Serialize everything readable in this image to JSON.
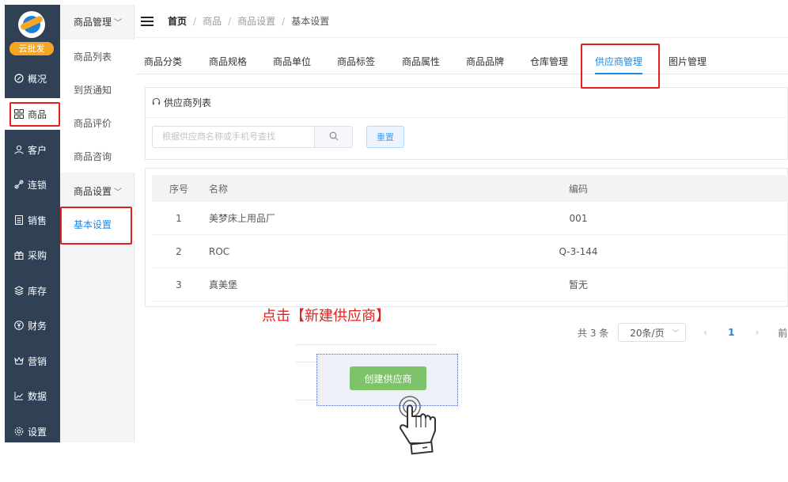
{
  "nav": {
    "brand": "云批发",
    "items": [
      {
        "label": "概况",
        "icon": "dashboard-icon"
      },
      {
        "label": "商品",
        "icon": "grid-icon"
      },
      {
        "label": "客户",
        "icon": "user-icon"
      },
      {
        "label": "连锁",
        "icon": "link-icon"
      },
      {
        "label": "销售",
        "icon": "document-icon"
      },
      {
        "label": "采购",
        "icon": "gift-icon"
      },
      {
        "label": "库存",
        "icon": "layers-icon"
      },
      {
        "label": "财务",
        "icon": "yen-icon"
      },
      {
        "label": "营销",
        "icon": "crown-icon"
      },
      {
        "label": "数据",
        "icon": "chart-icon"
      },
      {
        "label": "设置",
        "icon": "gear-icon"
      }
    ],
    "active": "商品"
  },
  "submenu": {
    "group1": "商品管理",
    "group1_items": [
      "商品列表",
      "到货通知",
      "商品评价",
      "商品咨询"
    ],
    "group2": "商品设置",
    "group2_items": [
      "基本设置"
    ]
  },
  "breadcrumb": {
    "home": "首页",
    "items": [
      "商品",
      "商品设置"
    ],
    "current": "基本设置",
    "separator": "/"
  },
  "tabs": [
    "商品分类",
    "商品规格",
    "商品单位",
    "商品标签",
    "商品属性",
    "商品品牌",
    "仓库管理",
    "供应商管理",
    "图片管理"
  ],
  "active_tab": "供应商管理",
  "panel": {
    "title": "供应商列表",
    "search_placeholder": "根据供应商名称或手机号查找",
    "reset_label": "重置"
  },
  "table": {
    "headers": [
      "序号",
      "名称",
      "编码"
    ],
    "rows": [
      {
        "index": "1",
        "name": "美梦床上用品厂",
        "code": "001"
      },
      {
        "index": "2",
        "name": "ROC",
        "code": "Q-3-144"
      },
      {
        "index": "3",
        "name": "真美堡",
        "code": "暂无"
      }
    ]
  },
  "pagination": {
    "total": "共 3 条",
    "page_size": "20条/页",
    "current": "1",
    "trailing": "前"
  },
  "instruction": "点击【新建供应商】",
  "create_button": "创建供应商",
  "colors": {
    "nav_bg": "#304156",
    "accent": "#1e88e5",
    "highlight": "#e02020",
    "create_green": "#7cc36a",
    "brand_orange": "#f5a623"
  }
}
